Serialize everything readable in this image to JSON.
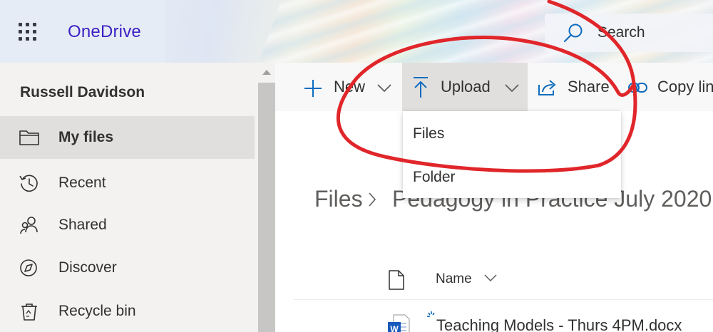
{
  "header": {
    "app_name": "OneDrive",
    "search_placeholder": "Search"
  },
  "sidebar": {
    "user_name": "Russell Davidson",
    "items": [
      {
        "label": "My files",
        "icon": "folder-icon",
        "selected": true
      },
      {
        "label": "Recent",
        "icon": "history-icon"
      },
      {
        "label": "Shared",
        "icon": "people-icon"
      },
      {
        "label": "Discover",
        "icon": "compass-icon"
      },
      {
        "label": "Recycle bin",
        "icon": "recycle-bin-icon"
      }
    ]
  },
  "commandbar": {
    "new_label": "New",
    "upload_label": "Upload",
    "share_label": "Share",
    "copy_link_label": "Copy link"
  },
  "upload_menu": {
    "items": [
      {
        "label": "Files"
      },
      {
        "label": "Folder"
      }
    ]
  },
  "breadcrumb": {
    "root": "Files",
    "current": "Pedagogy in Practice July 2020"
  },
  "file_list": {
    "name_column": "Name",
    "rows": [
      {
        "name": "Teaching Models - Thurs 4PM.docx",
        "icon": "word-file-icon"
      }
    ]
  },
  "colors": {
    "brand": "#3b20c4",
    "accent_blue": "#0078d4",
    "annotation": "#e0262a"
  }
}
